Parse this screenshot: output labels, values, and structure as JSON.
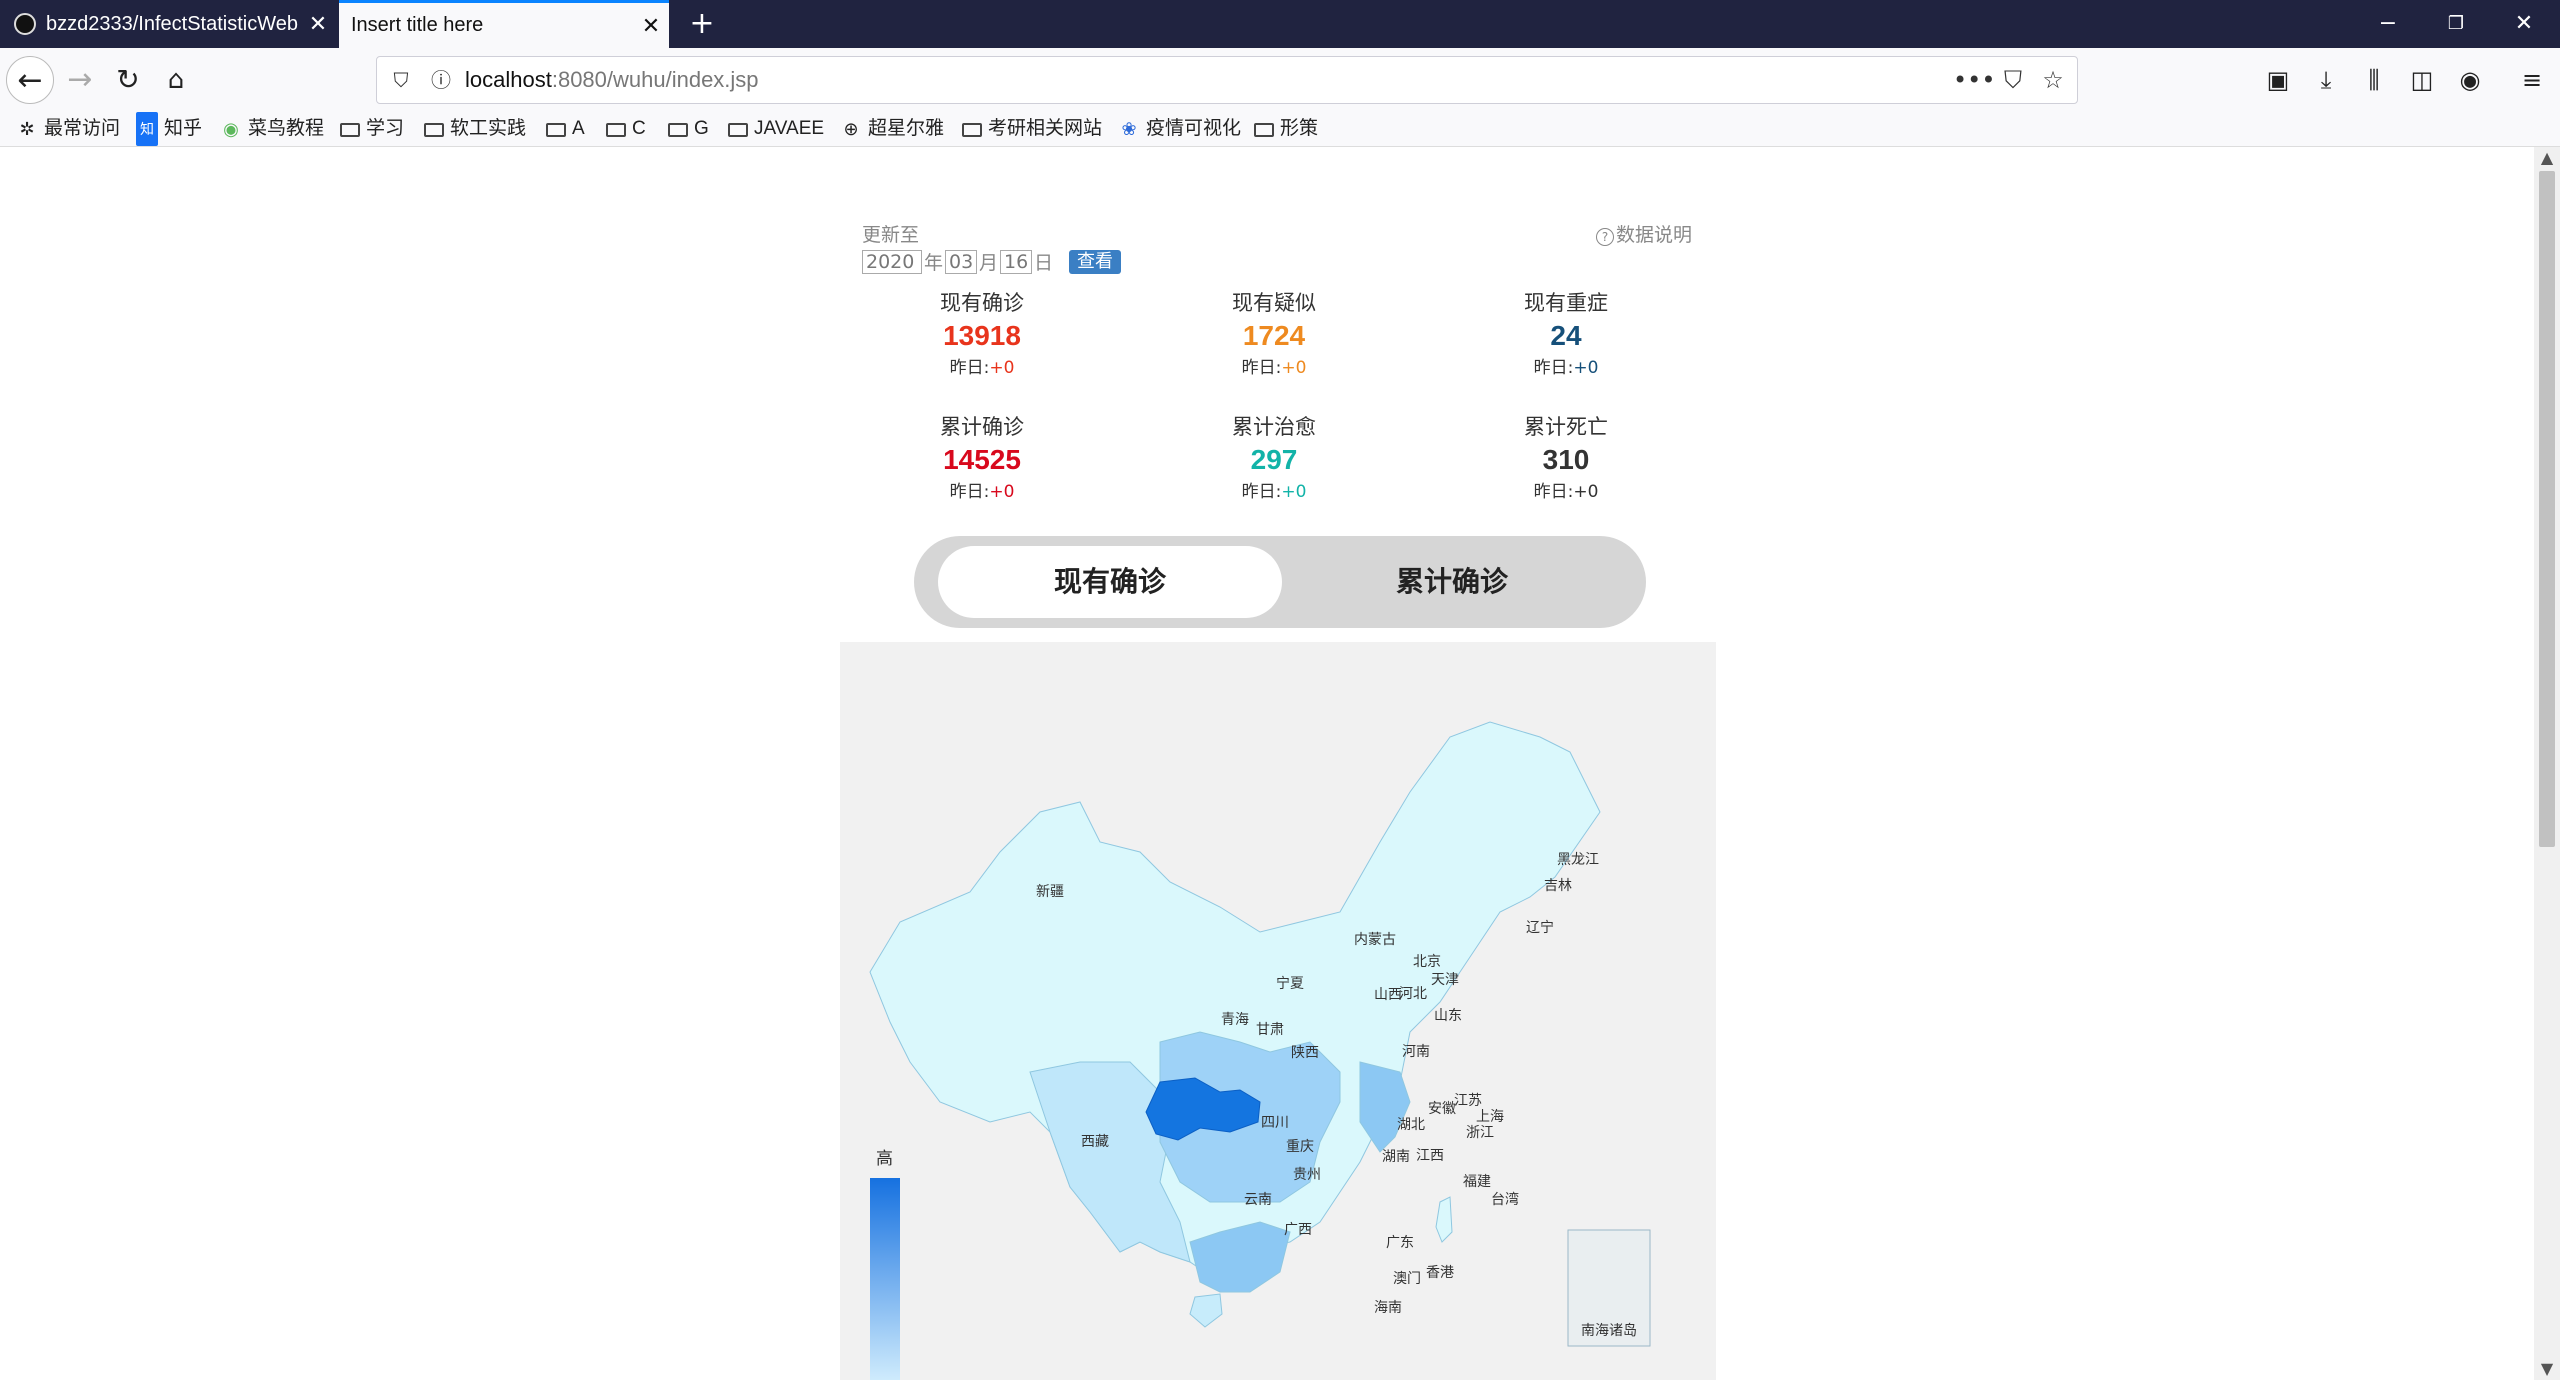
{
  "browser": {
    "tabs": [
      {
        "title": "bzzd2333/InfectStatisticWeb",
        "active": false
      },
      {
        "title": "Insert title here",
        "active": true
      }
    ],
    "url_host": "localhost",
    "url_rest": ":8080/wuhu/index.jsp",
    "bookmarks": [
      "最常访问",
      "知乎",
      "菜鸟教程",
      "学习",
      "软工实践",
      "A",
      "C",
      "G",
      "JAVAEE",
      "超星尔雅",
      "考研相关网站",
      "疫情可视化",
      "形策"
    ]
  },
  "page": {
    "update_label": "更新至",
    "data_note": "数据说明",
    "date": {
      "year": "2020",
      "year_unit": "年",
      "month": "03",
      "month_unit": "月",
      "day": "16",
      "day_unit": "日"
    },
    "view_button": "查看",
    "yesterday_label": "昨日:",
    "stats": [
      {
        "label": "现有确诊",
        "value": "13918",
        "delta": "+0",
        "color": "#e8341c",
        "delta_color": "#e8341c"
      },
      {
        "label": "现有疑似",
        "value": "1724",
        "delta": "+0",
        "color": "#ee8a20",
        "delta_color": "#ee8a20"
      },
      {
        "label": "现有重症",
        "value": "24",
        "delta": "+0",
        "color": "#16507a",
        "delta_color": "#16507a"
      },
      {
        "label": "累计确诊",
        "value": "14525",
        "delta": "+0",
        "color": "#d8091d",
        "delta_color": "#d8091d"
      },
      {
        "label": "累计治愈",
        "value": "297",
        "delta": "+0",
        "color": "#12b3a8",
        "delta_color": "#12b3a8"
      },
      {
        "label": "累计死亡",
        "value": "310",
        "delta": "+0",
        "color": "#333333",
        "delta_color": "#333333"
      }
    ],
    "toggle": {
      "active": "现有确诊",
      "other": "累计确诊"
    },
    "map": {
      "legend_high": "高",
      "inset_label": "南海诸岛",
      "provinces": [
        "新疆",
        "西藏",
        "青海",
        "甘肃",
        "宁夏",
        "内蒙古",
        "黑龙江",
        "吉林",
        "辽宁",
        "北京",
        "天津",
        "河北",
        "山西",
        "山东",
        "河南",
        "陕西",
        "四川",
        "重庆",
        "湖北",
        "安徽",
        "江苏",
        "上海",
        "浙江",
        "江西",
        "湖南",
        "贵州",
        "云南",
        "广西",
        "广东",
        "福建",
        "台湾",
        "香港",
        "澳门",
        "海南"
      ]
    }
  }
}
